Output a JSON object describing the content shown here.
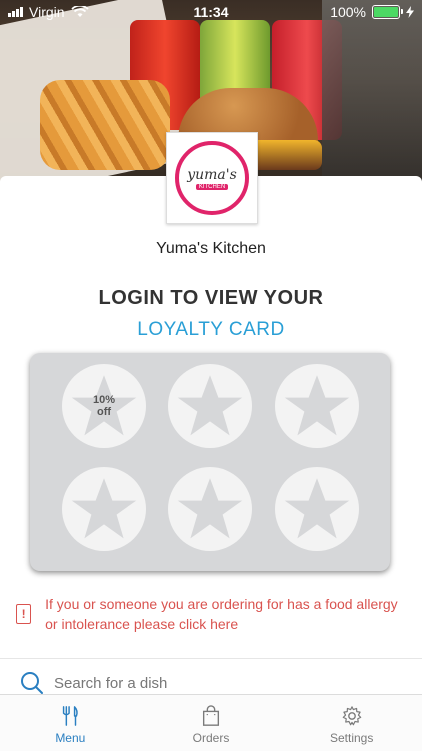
{
  "status_bar": {
    "carrier": "Virgin",
    "time": "11:34",
    "battery": "100%",
    "battery_level": 1.0
  },
  "restaurant": {
    "logo_text": "yuma's",
    "logo_tag": "KITCHEN",
    "name": "Yuma's Kitchen"
  },
  "loyalty": {
    "heading": "LOGIN TO VIEW YOUR",
    "subheading": "LOYALTY CARD",
    "reward_line1": "10%",
    "reward_line2": "off",
    "stamp_count": 6
  },
  "allergy_notice": {
    "icon": "alert-icon",
    "text": "If you or someone you are ordering for has a food allergy or intolerance please click here"
  },
  "search": {
    "placeholder": "Search for a dish"
  },
  "tabs": [
    {
      "label": "Menu",
      "icon": "fork-knife-icon",
      "active": true
    },
    {
      "label": "Orders",
      "icon": "bag-icon",
      "active": false
    },
    {
      "label": "Settings",
      "icon": "gear-icon",
      "active": false
    }
  ],
  "colors": {
    "accent": "#2a9fd6",
    "tab_active": "#2a7fc1",
    "alert": "#d9534f",
    "logo": "#e0246a"
  }
}
